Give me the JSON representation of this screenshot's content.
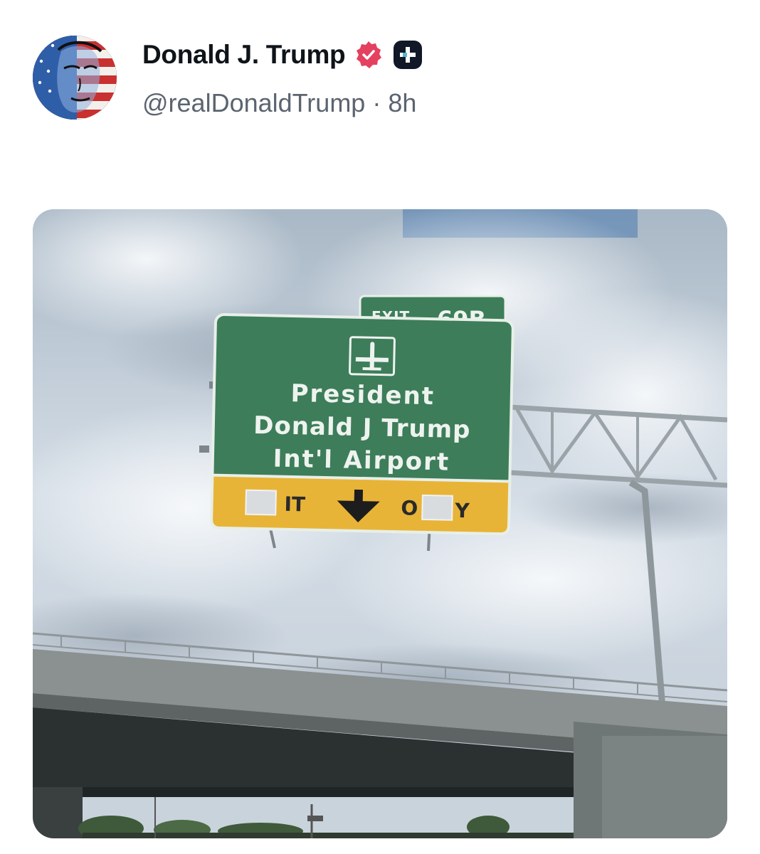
{
  "post": {
    "author": {
      "display_name": "Donald J. Trump",
      "handle": "@realDonaldTrump",
      "verified": true,
      "avatar_icon": "avatar-portrait-flag",
      "badges": [
        "verified-badge-icon",
        "plus-badge-icon"
      ]
    },
    "separator": "·",
    "time_ago": "8h",
    "media": {
      "type": "photo",
      "sign": {
        "exit_label": "EXIT",
        "exit_number": "69B",
        "line1": "President",
        "line2": "Donald J Trump",
        "line3": "Int'l Airport",
        "lane_left": "IT",
        "lane_right_a": "O",
        "lane_right_b": "Y"
      }
    }
  },
  "colors": {
    "verified_badge": "#e4405f",
    "sign_green": "#3d7d5a",
    "sign_yellow": "#e8b437",
    "sky": "#cfd8e1"
  }
}
